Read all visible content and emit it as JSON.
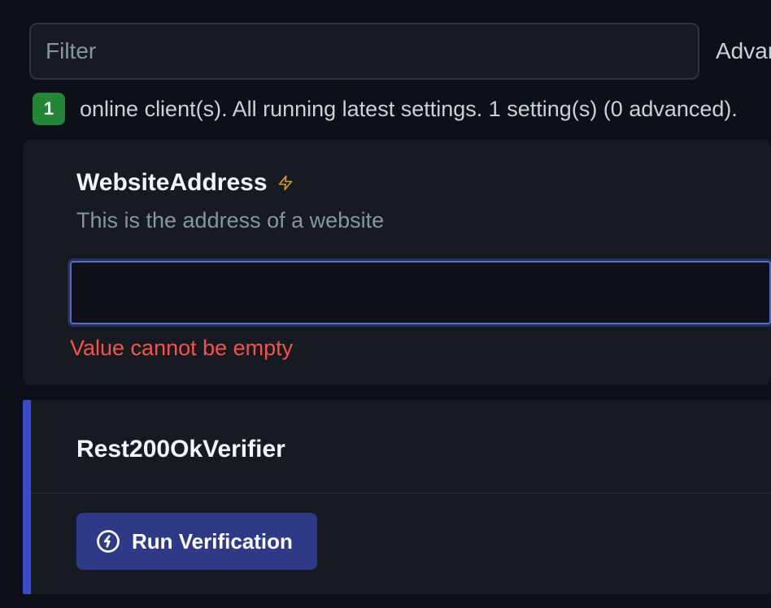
{
  "filter": {
    "placeholder": "Filter",
    "value": ""
  },
  "advanced_label": "Advanced",
  "status": {
    "count": "1",
    "text": "online client(s). All running latest settings. 1 setting(s) (0 advanced)."
  },
  "setting": {
    "title": "WebsiteAddress",
    "description": "This is the address of a website",
    "value": "",
    "error": "Value cannot be empty"
  },
  "verifier": {
    "title": "Rest200OkVerifier",
    "run_label": "Run Verification"
  },
  "colors": {
    "accent_blue": "#3b4acb",
    "button_blue": "#2e3a87",
    "badge_green": "#238636",
    "error_red": "#f85149",
    "border_focus": "#5866d3"
  }
}
